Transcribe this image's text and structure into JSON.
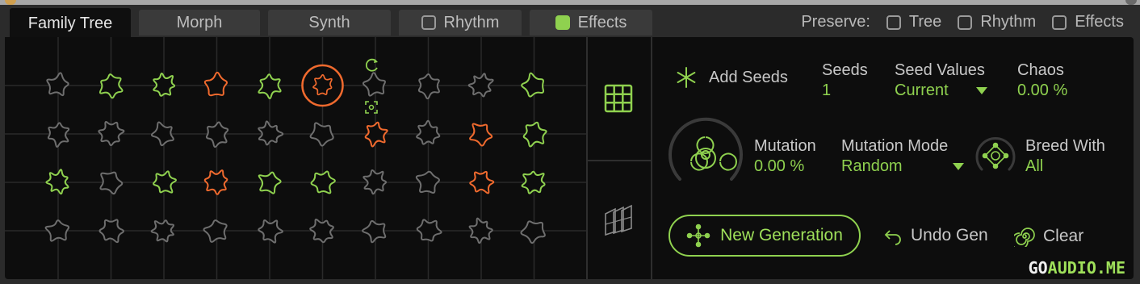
{
  "tabs": [
    {
      "label": "Family Tree",
      "active": true
    },
    {
      "label": "Morph"
    },
    {
      "label": "Synth"
    },
    {
      "label": "Rhythm",
      "checkbox": false
    },
    {
      "label": "Effects",
      "checkbox": true
    }
  ],
  "preserve": {
    "label": "Preserve:",
    "items": [
      {
        "label": "Tree",
        "checked": false
      },
      {
        "label": "Rhythm",
        "checked": false
      },
      {
        "label": "Effects",
        "checked": false
      }
    ]
  },
  "grid": {
    "rows": [
      [
        "gray",
        "green",
        "green",
        "orange",
        "green",
        "selected",
        "gray",
        "gray",
        "gray",
        "green"
      ],
      [
        "gray",
        "gray",
        "gray",
        "gray",
        "gray",
        "gray",
        "orange",
        "gray",
        "orange",
        "green"
      ],
      [
        "green",
        "gray",
        "green",
        "orange",
        "green",
        "green",
        "gray",
        "gray",
        "orange",
        "green"
      ],
      [
        "gray",
        "gray",
        "gray",
        "gray",
        "gray",
        "gray",
        "gray",
        "gray",
        "gray",
        "gray"
      ]
    ],
    "colors": {
      "gray": "#6e6e6e",
      "green": "#8fd14f",
      "orange": "#f06a2e"
    }
  },
  "controls": {
    "add_seeds": "Add Seeds",
    "seeds_label": "Seeds",
    "seeds_value": "1",
    "seed_values_label": "Seed Values",
    "seed_values_value": "Current",
    "chaos_label": "Chaos",
    "chaos_value": "0.00 %",
    "mutation_label": "Mutation",
    "mutation_value": "0.00 %",
    "mutation_mode_label": "Mutation Mode",
    "mutation_mode_value": "Random",
    "breed_with_label": "Breed With",
    "breed_with_value": "All"
  },
  "actions": {
    "new_generation": "New Generation",
    "undo_gen": "Undo Gen",
    "clear": "Clear"
  },
  "watermark": {
    "part1": "GO",
    "part2": "AUDIO.ME"
  },
  "icons": [
    "refresh-icon",
    "focus-icon",
    "grid-view-icon",
    "stack-view-icon",
    "asterisk-icon",
    "biohazard-icon",
    "breed-icon",
    "dropdown-arrow-icon",
    "network-icon",
    "undo-icon",
    "spiral-icon"
  ]
}
